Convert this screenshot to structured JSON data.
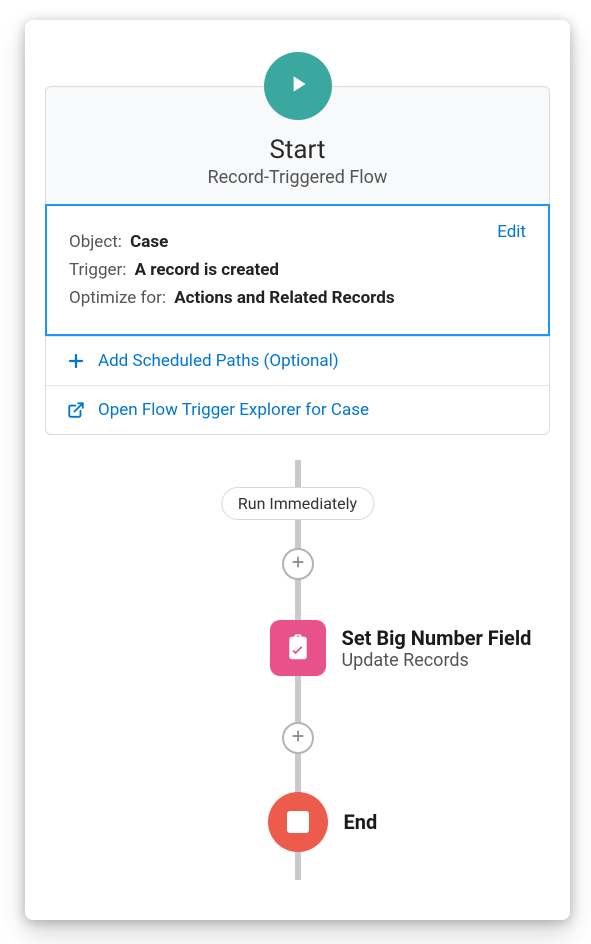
{
  "start": {
    "title": "Start",
    "subtitle": "Record-Triggered Flow",
    "config": {
      "object_label": "Object:",
      "object_value": "Case",
      "trigger_label": "Trigger:",
      "trigger_value": "A record is created",
      "optimize_label": "Optimize for:",
      "optimize_value": "Actions and Related Records",
      "edit_label": "Edit"
    },
    "actions": {
      "add_scheduled": "Add Scheduled Paths (Optional)",
      "open_explorer": "Open Flow Trigger Explorer for Case"
    }
  },
  "path": {
    "run_label": "Run Immediately"
  },
  "nodes": {
    "update": {
      "title": "Set Big Number Field",
      "subtitle": "Update Records"
    },
    "end": {
      "title": "End"
    }
  }
}
